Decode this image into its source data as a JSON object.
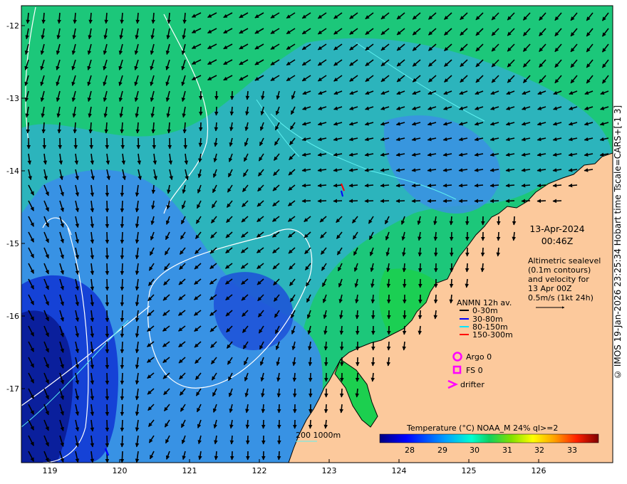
{
  "map": {
    "date": "13-Apr-2024",
    "time": "00:46Z",
    "altimetry_note": [
      "Altimetric sealevel",
      "(0.1m contours)",
      "and velocity for",
      "13 Apr 00Z",
      "0.5m/s (1kt 24h)"
    ],
    "lon_ticks": [
      "119",
      "120",
      "121",
      "122",
      "123",
      "124",
      "125",
      "126"
    ],
    "lat_ticks": [
      "-12",
      "-13",
      "-14",
      "-15",
      "-16",
      "-17"
    ],
    "anmn": {
      "title": "ANMN 12h av.",
      "items": [
        {
          "label": "0-30m",
          "color": "#000000"
        },
        {
          "label": "30-80m",
          "color": "#0000ff"
        },
        {
          "label": "80-150m",
          "color": "#00e5ff"
        },
        {
          "label": "150-300m",
          "color": "#ff0000"
        }
      ]
    },
    "markers": {
      "argo": "Argo 0",
      "fs": "FS 0",
      "drifter": "drifter",
      "color": "#ff00ff"
    },
    "bathy": "200  1000m",
    "colorbar": {
      "title": "Temperature (°C) NOAA_M 24% ql>=2",
      "ticks": [
        "28",
        "29",
        "30",
        "31",
        "32",
        "33"
      ]
    },
    "credit": "© IMOS 19-Jan-2026 23:25:34 Hobart time Tscale=CARS+[-1 3]",
    "colors": {
      "land": "#fcc99c",
      "sea_warm": "#1cc77a",
      "sea_mid": "#3aa0e6",
      "sea_cool": "#0f3bd0",
      "contour": "#ffffff",
      "bathy": "#5ff1f1"
    }
  }
}
